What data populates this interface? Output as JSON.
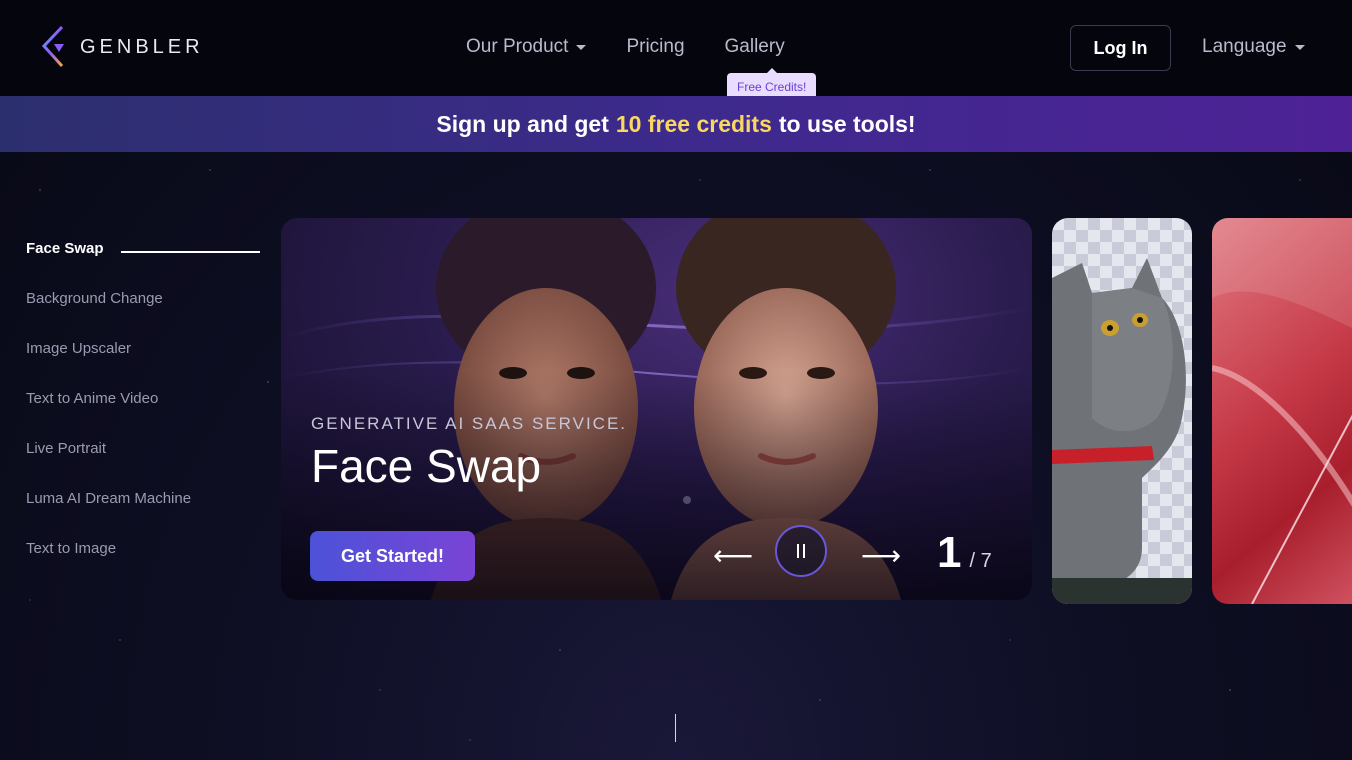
{
  "header": {
    "logo_text": "GENBLER",
    "nav": [
      {
        "label": "Our Product",
        "has_dropdown": true
      },
      {
        "label": "Pricing",
        "has_dropdown": false
      },
      {
        "label": "Gallery",
        "has_dropdown": false
      }
    ],
    "gallery_tooltip": "Free Credits!",
    "login_label": "Log In",
    "language_label": "Language"
  },
  "banner": {
    "text_before": "Sign up and get",
    "highlight": "10 free credits",
    "text_after": "to use tools!",
    "highlight_color": "#f8d762"
  },
  "sidebar": {
    "items": [
      {
        "label": "Face Swap",
        "active": true
      },
      {
        "label": "Background Change",
        "active": false
      },
      {
        "label": "Image Upscaler",
        "active": false
      },
      {
        "label": "Text to Anime Video",
        "active": false
      },
      {
        "label": "Live Portrait",
        "active": false
      },
      {
        "label": "Luma AI Dream Machine",
        "active": false
      },
      {
        "label": "Text to Image",
        "active": false
      }
    ]
  },
  "hero": {
    "subtitle": "GENERATIVE AI SAAS SERVICE.",
    "title": "Face Swap",
    "cta_label": "Get Started!",
    "prev_icon": "arrow-left-icon",
    "next_icon": "arrow-right-icon",
    "pause_icon": "pause-icon",
    "current_slide": "1",
    "total_slides": "/ 7"
  },
  "colors": {
    "accent_gradient_start": "#4c52d8",
    "accent_gradient_end": "#7a44d6",
    "banner_start": "#2c2f6e",
    "banner_end": "#4e2296"
  }
}
